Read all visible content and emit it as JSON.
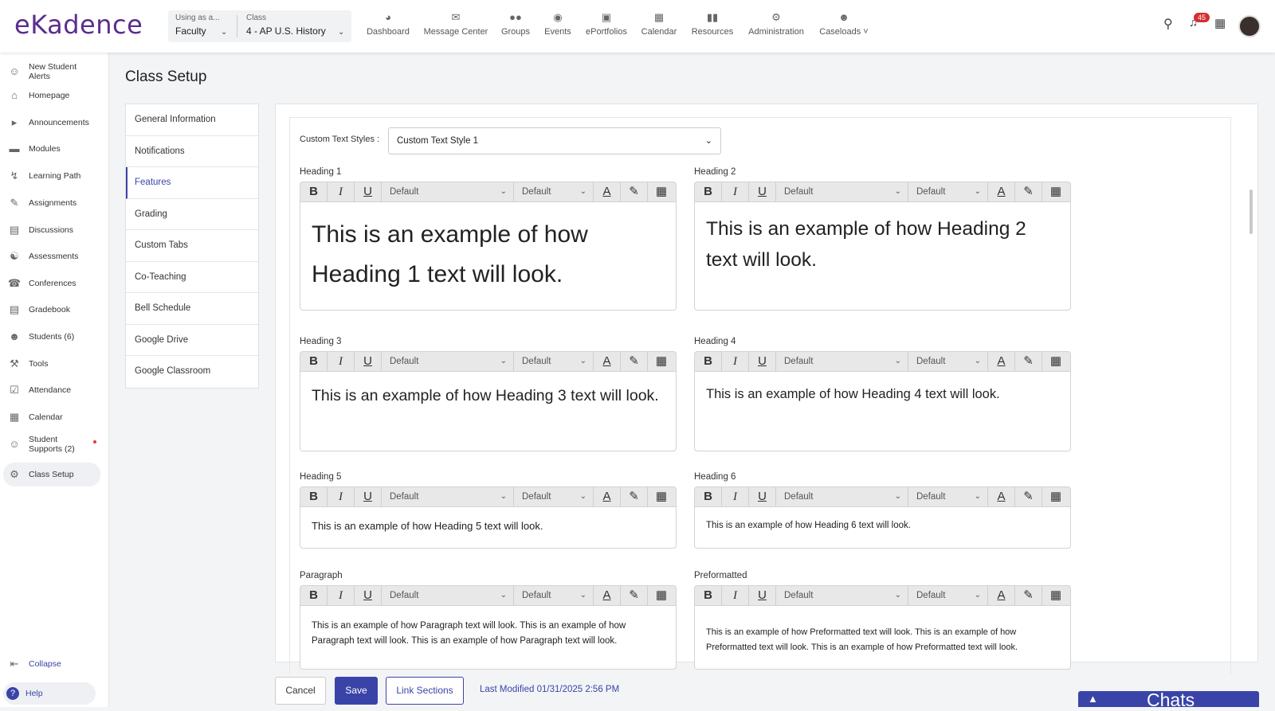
{
  "header": {
    "logo_text": "eKadence",
    "using_as_label": "Using as a...",
    "using_as_value": "Faculty",
    "class_label": "Class",
    "class_value": "4 - AP U.S. History",
    "nav": [
      {
        "label": "Dashboard",
        "icon": "dashboard-icon"
      },
      {
        "label": "Message Center",
        "icon": "message-icon"
      },
      {
        "label": "Groups",
        "icon": "groups-icon"
      },
      {
        "label": "Events",
        "icon": "location-pin-icon"
      },
      {
        "label": "ePortfolios",
        "icon": "portfolio-icon"
      },
      {
        "label": "Calendar",
        "icon": "calendar-icon"
      },
      {
        "label": "Resources",
        "icon": "resources-icon"
      },
      {
        "label": "Administration",
        "icon": "gears-icon"
      },
      {
        "label": "Caseloads",
        "icon": "person-icon"
      }
    ],
    "notification_count": "45"
  },
  "sidebar": {
    "items": [
      {
        "label": "New Student Alerts"
      },
      {
        "label": "Homepage"
      },
      {
        "label": "Announcements"
      },
      {
        "label": "Modules"
      },
      {
        "label": "Learning Path"
      },
      {
        "label": "Assignments"
      },
      {
        "label": "Discussions"
      },
      {
        "label": "Assessments"
      },
      {
        "label": "Conferences"
      },
      {
        "label": "Gradebook"
      },
      {
        "label": "Students (6)"
      },
      {
        "label": "Tools"
      },
      {
        "label": "Attendance"
      },
      {
        "label": "Calendar"
      },
      {
        "label": "Student Supports (2)"
      },
      {
        "label": "Class Setup"
      }
    ],
    "collapse_label": "Collapse",
    "help_label": "Help"
  },
  "page": {
    "title": "Class Setup",
    "subnav": [
      "General Information",
      "Notifications",
      "Features",
      "Grading",
      "Custom Tabs",
      "Co-Teaching",
      "Bell Schedule",
      "Google Drive",
      "Google Classroom"
    ],
    "active_subnav": "Features",
    "custom_text_styles_label": "Custom Text Styles :",
    "custom_text_styles_value": "Custom Text Style 1",
    "toolbar": {
      "bold": "B",
      "italic": "I",
      "underline": "U",
      "font_default": "Default",
      "size_default": "Default",
      "font_color": "A"
    },
    "editors": [
      {
        "label": "Heading 1",
        "text": "This is an example of how Heading 1 text will look."
      },
      {
        "label": "Heading 2",
        "text": "This is an example of how Heading 2 text will look."
      },
      {
        "label": "Heading 3",
        "text": "This is an example of how Heading 3 text will look."
      },
      {
        "label": "Heading 4",
        "text": "This is an example of how Heading 4 text will look."
      },
      {
        "label": "Heading 5",
        "text": "This is an example of how Heading 5 text will look."
      },
      {
        "label": "Heading 6",
        "text": "This is an example of how Heading 6 text will look."
      },
      {
        "label": "Paragraph",
        "text": "This is an example of how Paragraph text will look. This is an example of how Paragraph text will look. This is an example of how Paragraph text will look."
      },
      {
        "label": "Preformatted",
        "text": "This is an example of how Preformatted text will look. This is an example of how Preformatted text will look. This is an example of how Preformatted text will look."
      }
    ]
  },
  "footer": {
    "cancel_label": "Cancel",
    "save_label": "Save",
    "link_sections_label": "Link Sections",
    "last_modified": "Last Modified 01/31/2025 2:56 PM",
    "chats_label": "Chats"
  },
  "colors": {
    "accent": "#3a44a8",
    "brand": "#5b2d8e",
    "badge": "#d32f2f"
  }
}
